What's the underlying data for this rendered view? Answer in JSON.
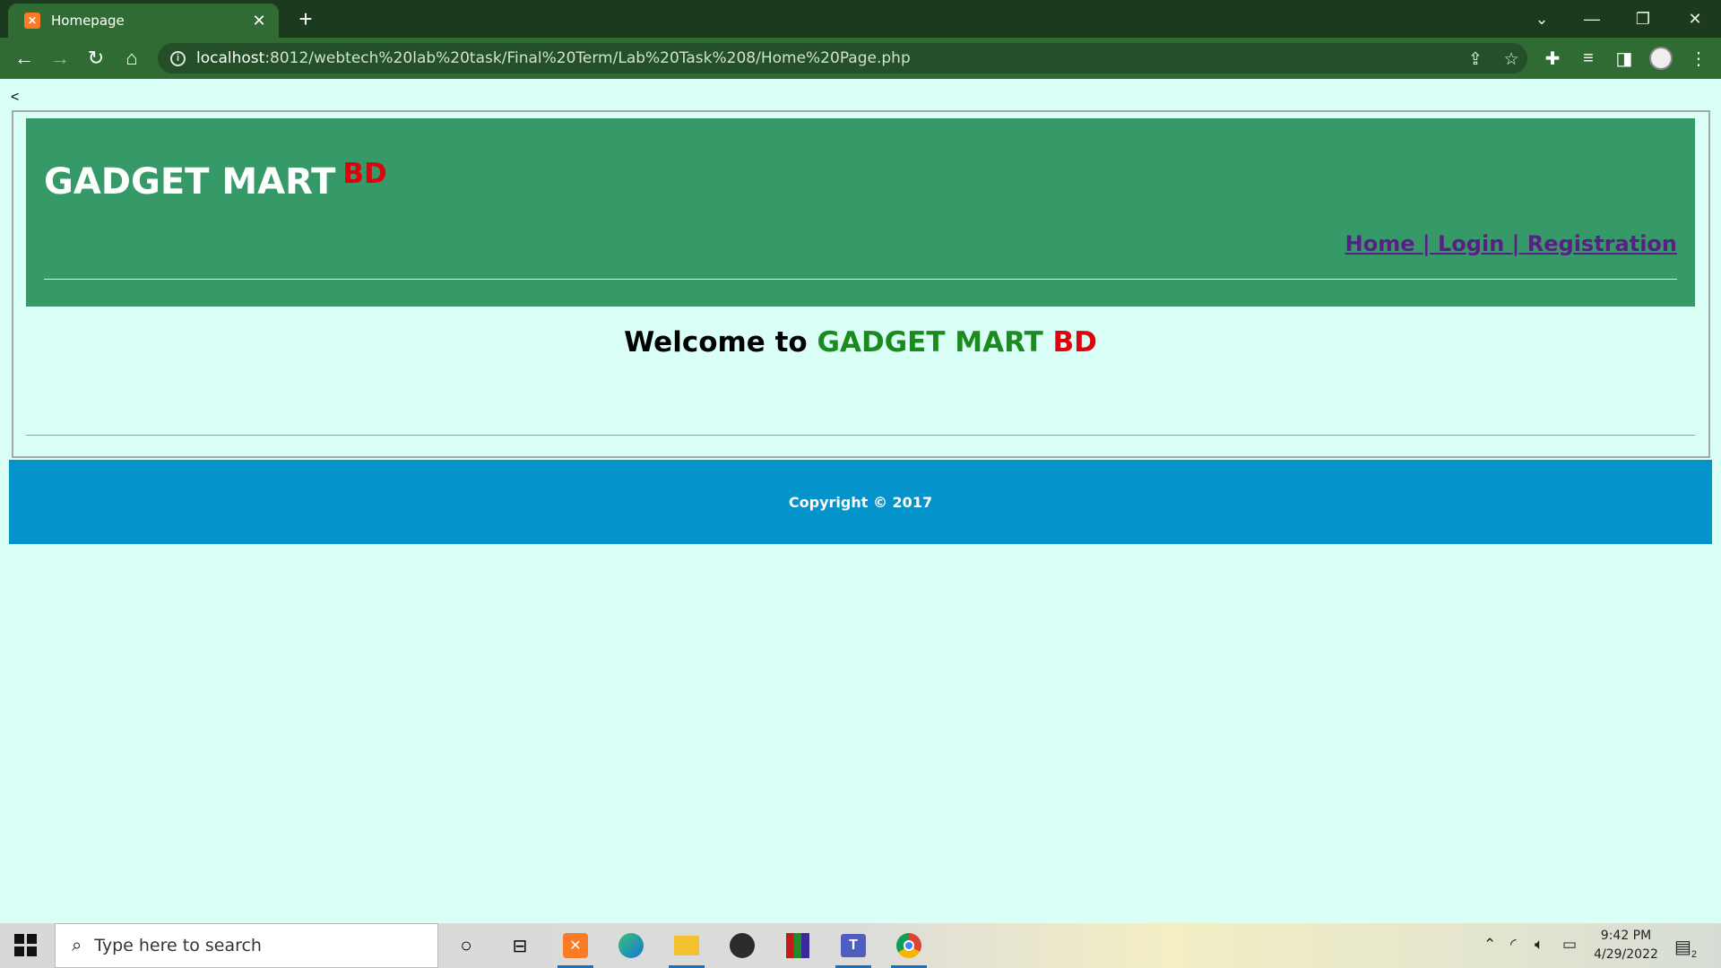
{
  "browser": {
    "tab_title": "Homepage",
    "tab_favicon": "xampp-icon",
    "url_host": "localhost",
    "url_rest": ":8012/webtech%20lab%20task/Final%20Term/Lab%20Task%208/Home%20Page.php"
  },
  "page": {
    "stray_text": "<",
    "logo_main": "GADGET MART",
    "logo_sup": "BD",
    "nav": {
      "home": "Home",
      "login": "Login",
      "registration": "Registration",
      "separator": "|"
    },
    "welcome_prefix": "Welcome to",
    "welcome_brand": "GADGET MART",
    "welcome_bd": "BD",
    "footer": "Copyright © 2017"
  },
  "taskbar": {
    "search_placeholder": "Type here to search",
    "time": "9:42 PM",
    "date": "4/29/2022",
    "notifications": "2"
  },
  "colors": {
    "header_green": "#359a68",
    "footer_blue": "#0493cb",
    "page_bg": "#d9fff6",
    "brand_red": "#e0010e",
    "link_purple": "#5a1f86",
    "brand_green": "#1c8b1f"
  }
}
